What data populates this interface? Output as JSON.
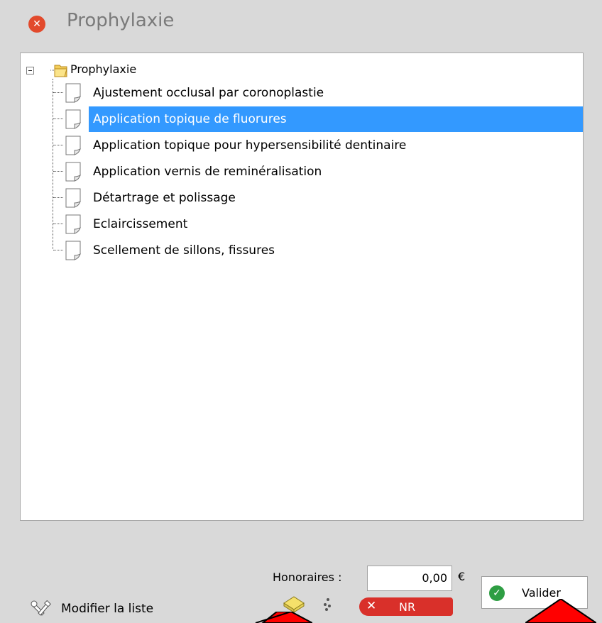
{
  "window": {
    "title": "Prophylaxie"
  },
  "tree": {
    "root_label": "Prophylaxie",
    "items": [
      {
        "label": "Ajustement occlusal par coronoplastie",
        "selected": false
      },
      {
        "label": "Application topique de fluorures",
        "selected": true
      },
      {
        "label": "Application topique pour hypersensibilité dentinaire",
        "selected": false
      },
      {
        "label": "Application vernis de reminéralisation",
        "selected": false
      },
      {
        "label": "Détartrage et polissage",
        "selected": false
      },
      {
        "label": "Eclaircissement",
        "selected": false
      },
      {
        "label": "Scellement de sillons, fissures",
        "selected": false
      }
    ]
  },
  "footer": {
    "honoraires_label": "Honoraires :",
    "honoraires_value": "0,00",
    "currency": "€",
    "valider_label": "Valider",
    "modifier_label": "Modifier la liste",
    "nr_label": "NR",
    "nr_x": "✕"
  },
  "colors": {
    "selection": "#3399ff",
    "close": "#e24a2c",
    "valid": "#2e9e43",
    "nr_badge": "#d9302a",
    "arrow": "#ff0000"
  }
}
